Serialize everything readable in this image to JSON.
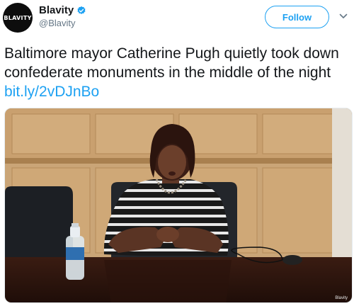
{
  "account": {
    "display_name": "Blavity",
    "handle": "@Blavity",
    "avatar_text": "BLAVITY",
    "verified": true
  },
  "actions": {
    "follow_label": "Follow",
    "menu_icon": "chevron-down-icon"
  },
  "tweet": {
    "text": "Baltimore mayor Catherine Pugh quietly took down confederate monuments in the middle of the night ",
    "link": "bit.ly/2vDJnBo"
  },
  "media": {
    "watermark": "Blavity"
  },
  "colors": {
    "accent": "#1da1f2",
    "text": "#14171a",
    "secondary": "#657786"
  }
}
